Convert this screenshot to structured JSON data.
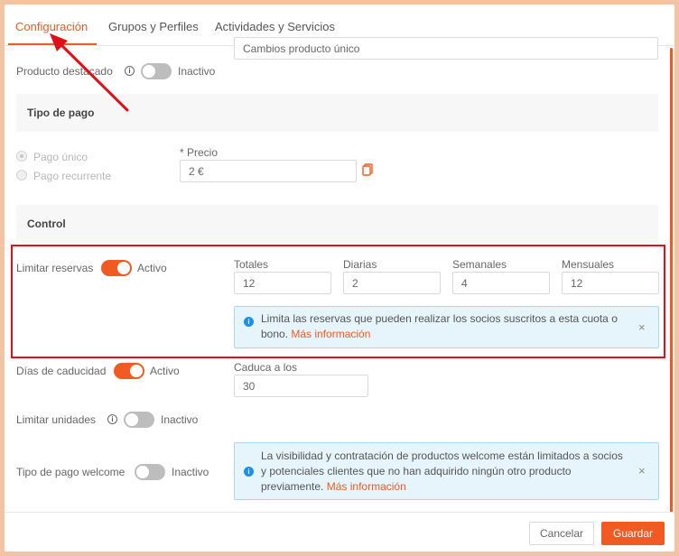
{
  "tabs": [
    {
      "label": "Configuración",
      "active": true
    },
    {
      "label": "Grupos y Perfiles",
      "active": false
    },
    {
      "label": "Actividades y Servicios",
      "active": false
    }
  ],
  "product_name_field": {
    "value": "Cambios producto único"
  },
  "featured": {
    "label": "Producto destacado",
    "state": "Inactivo",
    "on": false
  },
  "payment_type": {
    "title": "Tipo de pago",
    "options": [
      {
        "label": "Pago único",
        "checked": true
      },
      {
        "label": "Pago recurrente",
        "checked": false
      }
    ],
    "price_label": "* Precio",
    "price_value": "2 €"
  },
  "control": {
    "title": "Control",
    "limit_bookings": {
      "label": "Limitar reservas",
      "state": "Activo",
      "on": true,
      "fields": [
        {
          "label": "Totales",
          "value": "12"
        },
        {
          "label": "Diarias",
          "value": "2"
        },
        {
          "label": "Semanales",
          "value": "4"
        },
        {
          "label": "Mensuales",
          "value": "12"
        }
      ],
      "info_text": "Limita las reservas que pueden realizar los socios suscritos a esta cuota o bono.",
      "info_link": "Más información"
    },
    "expiry_days": {
      "label": "Días de caducidad",
      "state": "Activo",
      "on": true,
      "field_label": "Caduca a los",
      "field_value": "30"
    },
    "limit_units": {
      "label": "Limitar unidades",
      "state": "Inactivo",
      "on": false
    },
    "welcome_payment": {
      "label": "Tipo de pago welcome",
      "state": "Inactivo",
      "on": false,
      "info_text": "La visibilidad y contratación de productos welcome están limitados a socios y potenciales clientes que no han adquirido ningún otro producto previamente.",
      "info_link": "Más información"
    }
  },
  "footer": {
    "cancel_label": "Cancelar",
    "save_label": "Guardar"
  },
  "icons": {
    "info": "info-icon",
    "close": "close-icon",
    "copy": "copy-icon"
  },
  "colors": {
    "accent": "#f15a22",
    "annotation": "#e0101a",
    "info_bg": "#e6f4fc",
    "info_icon": "#1e90e8",
    "page_border": "#f2c4a4"
  }
}
